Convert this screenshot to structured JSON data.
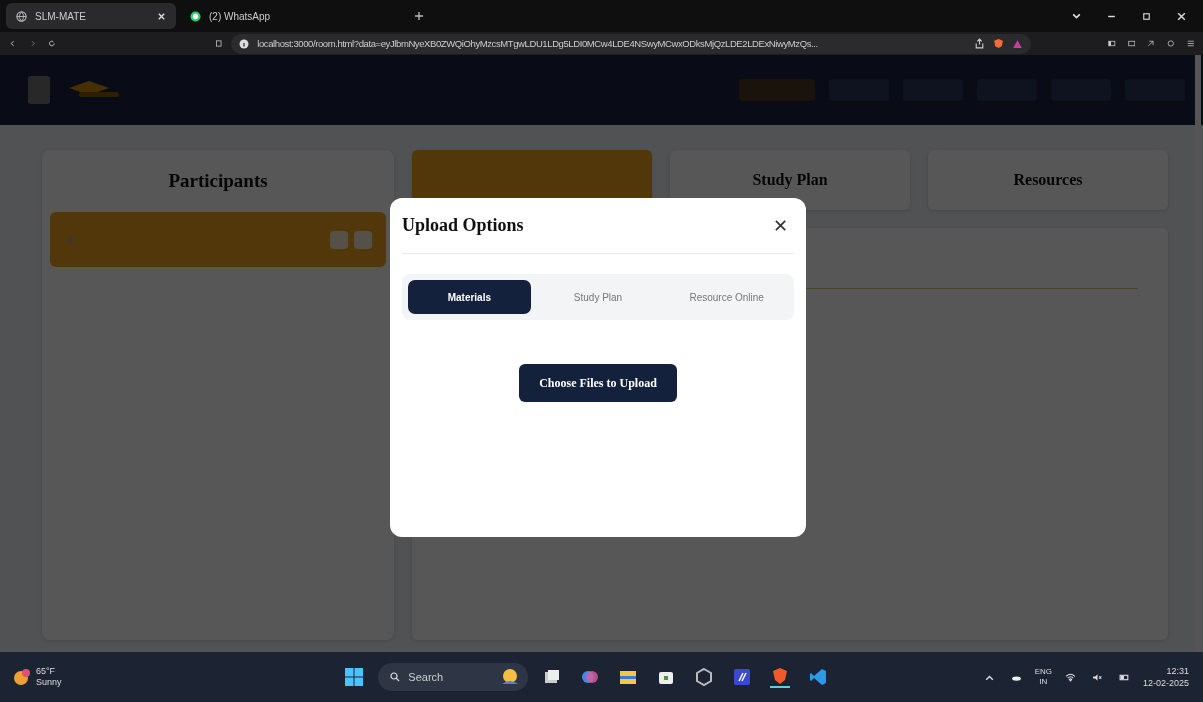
{
  "browser": {
    "tabs": [
      {
        "label": "SLM-MATE",
        "selected": true
      },
      {
        "label": "(2) WhatsApp",
        "selected": false
      }
    ],
    "url": "localhost:3000/room.html?data=eyJlbmNyeXB0ZWQiOhyMzcsMTgwLDU1LDg5LDI0MCw4LDE4NSwyMCwxODksMjQzLDE2LDExNiwyMzQs..."
  },
  "app": {
    "participants_title": "Participants",
    "section_tabs": [
      {
        "selected": true
      },
      {
        "label": "Study Plan",
        "selected": false
      },
      {
        "label": "Resources",
        "selected": false
      }
    ]
  },
  "modal": {
    "title": "Upload Options",
    "close": "✕",
    "tabs": [
      {
        "label": "Materials",
        "selected": true
      },
      {
        "label": "Study Plan",
        "selected": false
      },
      {
        "label": "Resource Online",
        "selected": false
      }
    ],
    "upload_button": "Choose Files to Upload"
  },
  "taskbar": {
    "weather": {
      "temperature": "65°F",
      "condition": "Sunny"
    },
    "search": {
      "placeholder": "Search"
    },
    "language": "ENG",
    "region": "IN",
    "time": "12:31",
    "date": "12-02-2025"
  }
}
